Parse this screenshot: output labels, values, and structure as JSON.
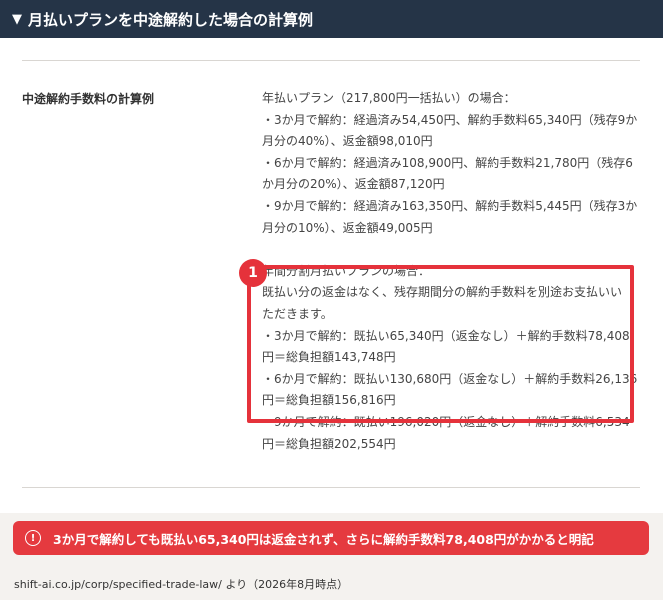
{
  "header": {
    "triangle": "▼",
    "title": "月払いプランを中途解約した場合の計算例"
  },
  "section": {
    "term": "中途解約手数料の計算例",
    "lines": [
      "年払いプラン（217,800円一括払い）の場合：",
      "・3か月で解約：経過済み54,450円、解約手数料65,340円（残存9か",
      "月分の40%）、返金額98,010円",
      "・6か月で解約：経過済み108,900円、解約手数料21,780円（残存6",
      "か月分の20%）、返金額87,120円",
      "・9か月で解約：経過済み163,350円、解約手数料5,445円（残存3か",
      "月分の10%）、返金額49,005円",
      "",
      "年間分割月払いプランの場合：",
      "既払い分の返金はなく、残存期間分の解約手数料を別途お支払いい",
      "ただきます。",
      "・3か月で解約：既払い65,340円（返金なし）＋解約手数料78,408",
      "円＝総負担額143,748円",
      "・6か月で解約：既払い130,680円（返金なし）＋解約手数料26,136",
      "円＝総負担額156,816円",
      "・9か月で解約：既払い196,020円（返金なし）＋解約手数料6,534",
      "円＝総負担額202,554円"
    ]
  },
  "annotation": {
    "badge": "1",
    "color": "#e5323b"
  },
  "banner": {
    "icon_text": "!",
    "text": "3か月で解約しても既払い65,340円は返金されず、さらに解約手数料78,408円がかかると明記"
  },
  "source": "shift-ai.co.jp/corp/specified-trade-law/ より（2026年8月時点）"
}
